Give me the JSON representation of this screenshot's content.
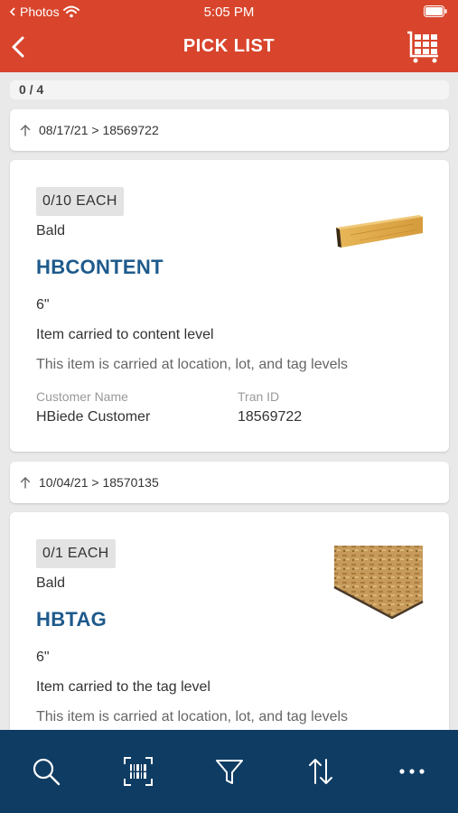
{
  "status_bar": {
    "back_app": "Photos",
    "time": "5:05 PM"
  },
  "header": {
    "title": "PICK LIST"
  },
  "progress": {
    "text": "0 / 4"
  },
  "groups": [
    {
      "label": "08/17/21 > 18569722",
      "item": {
        "quantity": "0/10 EACH",
        "status": "Bald",
        "name": "HBCONTENT",
        "dimension": "6\"",
        "description": "Item carried to content level",
        "note": "This item is carried at location, lot, and tag levels",
        "customer_label": "Customer Name",
        "customer_value": "HBiede Customer",
        "tran_label": "Tran ID",
        "tran_value": "18569722",
        "image": "lumber-beam-image"
      }
    },
    {
      "label": "10/04/21 > 18570135",
      "item": {
        "quantity": "0/1 EACH",
        "status": "Bald",
        "name": "HBTAG",
        "dimension": "6\"",
        "description": "Item carried to the tag level",
        "note": "This item is carried at location, lot, and tag levels",
        "image": "osb-board-image"
      }
    }
  ],
  "toolbar": {
    "icons": [
      "search-icon",
      "barcode-scan-icon",
      "filter-icon",
      "sort-icon",
      "more-icon"
    ]
  },
  "colors": {
    "header": "#d8452c",
    "toolbar": "#0f3c63",
    "item_name": "#1e5a8c",
    "background": "#e9e9e9"
  }
}
